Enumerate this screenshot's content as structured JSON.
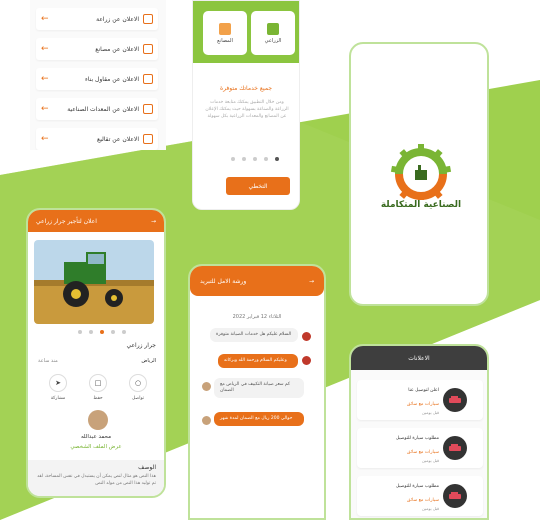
{
  "colors": {
    "accent": "#e8701a",
    "brand_green": "#8bc53f",
    "dark": "#3e3e3e"
  },
  "list_screen": {
    "items": [
      {
        "label": "الاعلان عن زراعة",
        "icon": "plant-icon"
      },
      {
        "label": "الاعلان عن مصانع",
        "icon": "factory-icon"
      },
      {
        "label": "الاعلان عن مقاول بناء",
        "icon": "crane-icon"
      },
      {
        "label": "الاعلان عن المعدات الصناعية",
        "icon": "truck-icon"
      },
      {
        "label": "الاعلان عن تقاليع",
        "icon": "gear-icon"
      }
    ]
  },
  "onboarding": {
    "tiles": [
      {
        "label": "المصانع"
      },
      {
        "label": "الزراعي"
      }
    ],
    "title": "جميع خدماتك متوفرة",
    "body": "ومن خلال التطبيق يمكنك متابعة خدمات الزراعة والصناعة بسهولة حيث يمكنك الإعلان عن المصانع والمعدات الزراعية بكل سهولة",
    "dots": 5,
    "active_dot": 4,
    "skip_label": "التخطي"
  },
  "splash": {
    "brand_name": "الصناعية المتكاملة"
  },
  "product": {
    "header_title": "اعلان لتأجير جرار زراعي",
    "name": "جرار زراعي",
    "location": "الرياض",
    "time": "منذ ساعة",
    "actions": [
      {
        "label": "تواصل",
        "icon": "chat-icon"
      },
      {
        "label": "حفظ",
        "icon": "bookmark-icon"
      },
      {
        "label": "مشاركة",
        "icon": "share-icon"
      }
    ],
    "owner": "محمد عبدالله",
    "profile_link": "عرض الملف الشخصي",
    "desc_title": "الوصف",
    "desc_text": "هذا النص هو مثال لنص يمكن أن يستبدل في نفس المساحة، لقد تم توليد هذا النص من مولد النص"
  },
  "chat": {
    "header_title": "ورشة الامل للتبريد",
    "date": "الثلاثاء 12 فبراير 2022",
    "messages": [
      {
        "text": "السلام عليكم هل خدمات الصيانة متوفرة",
        "dir": "in"
      },
      {
        "text": "وعليكم السلام ورحمة الله وبركاته",
        "dir": "out"
      },
      {
        "text": "كم سعر صيانة التكييف في الرياض مع الضمان",
        "dir": "in"
      },
      {
        "text": "حوالي 200 ريال مع الضمان لمدة شهر",
        "dir": "out"
      }
    ]
  },
  "notifications": {
    "header_title": "الاعلانات",
    "items": [
      {
        "title": "اعلن لتوصيل عنا",
        "sub": "سيارات مع سائق",
        "meta": "قبل يومين"
      },
      {
        "title": "مطلوب سيارة للتوصيل",
        "sub": "سيارات مع سائق",
        "meta": "قبل يومين"
      },
      {
        "title": "مطلوب سيارة للتوصيل",
        "sub": "سيارات مع سائق",
        "meta": "قبل يومين"
      }
    ]
  }
}
